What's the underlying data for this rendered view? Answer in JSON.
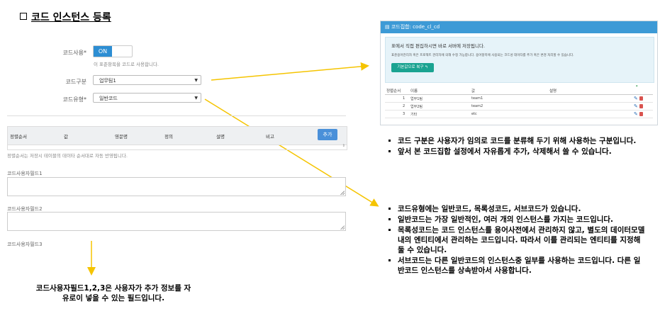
{
  "title": "코드 인스턴스 등록",
  "form": {
    "use_label": "코드사용*",
    "toggle_on": "ON",
    "use_hint": "이 표준항목을 코드로 사용합니다.",
    "type_label": "코드구분",
    "type_value": "업무팀1",
    "kind_label": "코드유형*",
    "kind_value": "일반코드"
  },
  "table": {
    "headers": [
      "정렬순서",
      "값",
      "영문명",
      "정의",
      "설명",
      "비고"
    ],
    "add_button": "추가",
    "note": "정렬순서는 저장시 테이블의 데이타 순서대로 자동 반영됩니다."
  },
  "fields": [
    {
      "label": "코드사용자필드1"
    },
    {
      "label": "코드사용자필드2"
    },
    {
      "label": "코드사용자필드3"
    }
  ],
  "caption": {
    "line1": "코드사용자필드1,2,3은 사용자가 추가 정보를 자",
    "line2": "유로이 넣을 수 있는 필드입니다."
  },
  "panel": {
    "header": "코드집합: code_cl_cd",
    "info_title": "표에서 직접 편집하시면 바로 서버에 저장됩니다.",
    "info_text": "표준용어관리자 혹은 프로젝트 관리자에 의해 수정 가능합니다. 용어항목에 사용되는 코드성 데이타를 추가 혹은 변경 처리할 수 있습니다.",
    "restore_button": "기본값으로 복구 ↰",
    "columns": [
      "정렬순서",
      "이름",
      "값",
      "설명"
    ],
    "rows": [
      {
        "order": "1",
        "name": "업무1팀",
        "value": "team1"
      },
      {
        "order": "2",
        "name": "업무2팀",
        "value": "team2"
      },
      {
        "order": "3",
        "name": "기타",
        "value": "etc"
      }
    ]
  },
  "bullets_top": [
    "코드 구분은 사용자가 임의로 코드를 분류해 두기 위해 사용하는 구분입니다.",
    "앞서 본 코드집합 설정에서 자유롭게 추가, 삭제해서 쓸 수 있습니다."
  ],
  "bullets_bottom": [
    "코드유형에는 일반코드, 목록성코드, 서브코드가 있습니다.",
    "일반코드는 가장 일반적인, 여러 개의 인스턴스를 가지는 코드입니다.",
    "목록성코드는 코드 인스턴스를 용어사전에서 관리하지 않고, 별도의 데이터모델 내의 엔티티에서 관리하는 코드입니다. 따라서 이를 관리되는 엔티티를 지정해 둘 수 있습니다.",
    "서브코드는 다른 일반코드의 인스턴스중 일부를 사용하는 코드입니다. 다른 일반코드 인스턴스를 상속받아서 사용합니다."
  ],
  "colors": {
    "accent": "#2d8ed3",
    "arrow": "#f5c400",
    "teal": "#1aa391"
  }
}
